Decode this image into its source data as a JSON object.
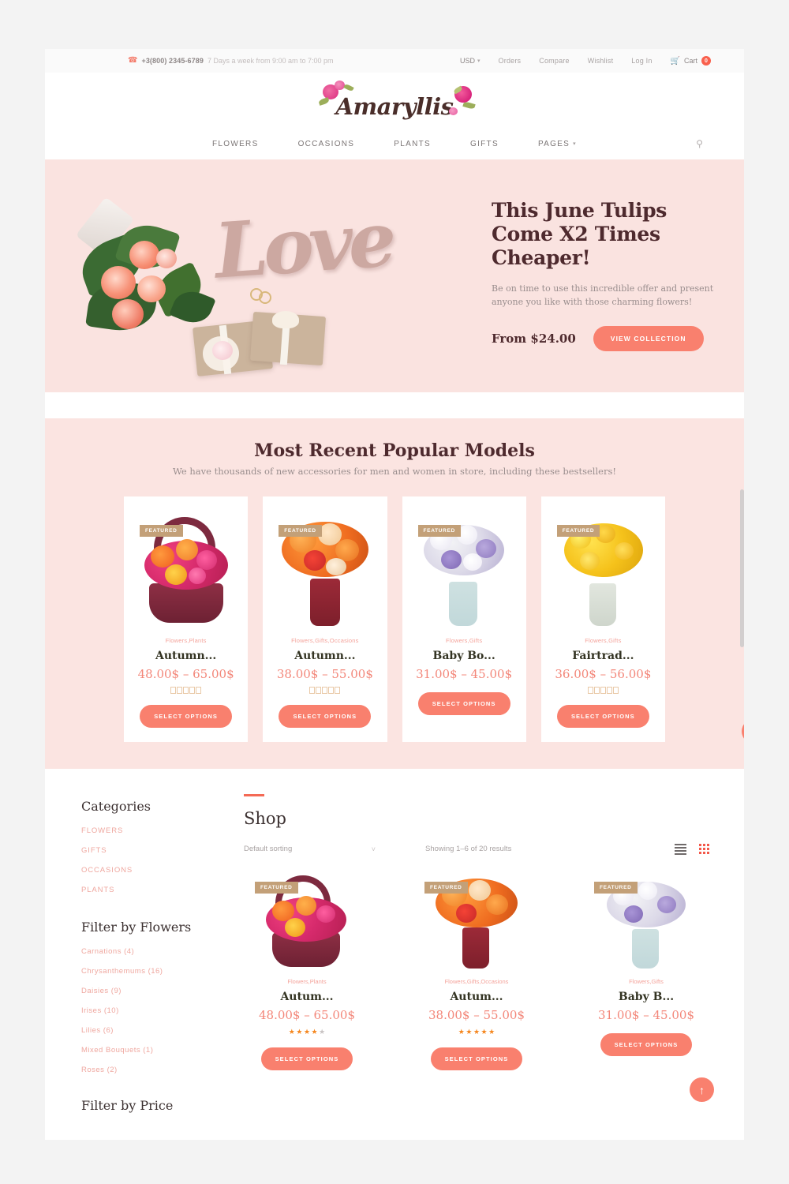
{
  "topbar": {
    "phone_icon": "phone-icon",
    "phone": "+3(800) 2345-6789",
    "hours": "7 Days a week from 9:00 am to 7:00 pm",
    "currency": "USD",
    "links": [
      "Orders",
      "Compare",
      "Wishlist",
      "Log In"
    ],
    "cart_label": "Cart",
    "cart_count": "0"
  },
  "header": {
    "logo": "Amaryllis"
  },
  "nav": {
    "items": [
      {
        "label": "FLOWERS",
        "has_caret": false
      },
      {
        "label": "OCCASIONS",
        "has_caret": false
      },
      {
        "label": "PLANTS",
        "has_caret": false
      },
      {
        "label": "GIFTS",
        "has_caret": false
      },
      {
        "label": "PAGES",
        "has_caret": true
      }
    ],
    "search_icon": "search-icon"
  },
  "hero": {
    "decor_word": "Love",
    "heading": "This June Tulips Come X2 Times Cheaper!",
    "paragraph": "Be on time to use this incredible offer and present anyone you like with those charming flowers!",
    "price": "From $24.00",
    "cta": "VIEW COLLECTION"
  },
  "popular": {
    "title": "Most Recent Popular Models",
    "subtitle": "We have thousands of new accessories for men and women in store, including these bestsellers!",
    "badge": "FEATURED",
    "button": "SELECT OPTIONS",
    "products": [
      {
        "category": "Flowers,Plants",
        "title": "Autumn...",
        "price": "48.00$ – 65.00$",
        "rating": 5,
        "show_rating": true
      },
      {
        "category": "Flowers,Gifts,Occasions",
        "title": "Autumn...",
        "price": "38.00$ – 55.00$",
        "rating": 5,
        "show_rating": true
      },
      {
        "category": "Flowers,Gifts",
        "title": "Baby Bo...",
        "price": "31.00$ – 45.00$",
        "rating": 0,
        "show_rating": false
      },
      {
        "category": "Flowers,Gifts",
        "title": "Fairtrad...",
        "price": "36.00$ – 56.00$",
        "rating": 5,
        "show_rating": true
      }
    ]
  },
  "sidebar": {
    "categories_heading": "Categories",
    "categories": [
      "FLOWERS",
      "GIFTS",
      "OCCASIONS",
      "PLANTS"
    ],
    "filter_flowers_heading": "Filter by Flowers",
    "flowers": [
      "Carnations (4)",
      "Chrysanthemums (16)",
      "Daisies (9)",
      "Irises (10)",
      "Lilies (6)",
      "Mixed Bouquets (1)",
      "Roses (2)"
    ],
    "filter_price_heading": "Filter by Price"
  },
  "shop": {
    "title": "Shop",
    "sort_value": "Default sorting",
    "results": "Showing 1–6 of 20 results",
    "list_view_icon": "list-view-icon",
    "grid_view_icon": "grid-view-icon",
    "badge": "FEATURED",
    "button": "SELECT OPTIONS",
    "products": [
      {
        "category": "Flowers,Plants",
        "title": "Autum...",
        "price": "48.00$ – 65.00$",
        "rating": 4,
        "show_rating": true
      },
      {
        "category": "Flowers,Gifts,Occasions",
        "title": "Autum...",
        "price": "38.00$ – 55.00$",
        "rating": 5,
        "show_rating": true
      },
      {
        "category": "Flowers,Gifts",
        "title": "Baby B...",
        "price": "31.00$ – 45.00$",
        "rating": 0,
        "show_rating": false
      }
    ]
  },
  "floating": {
    "side_button_icon": "panel-toggle-icon",
    "scroll_top_icon": "arrow-up-icon"
  },
  "colors": {
    "accent": "#f9806e",
    "price": "#f3877a",
    "category": "#f4a39b",
    "badge": "#c3a078",
    "hero_bg": "#fbe4e1",
    "heading": "#4e2a2e"
  }
}
